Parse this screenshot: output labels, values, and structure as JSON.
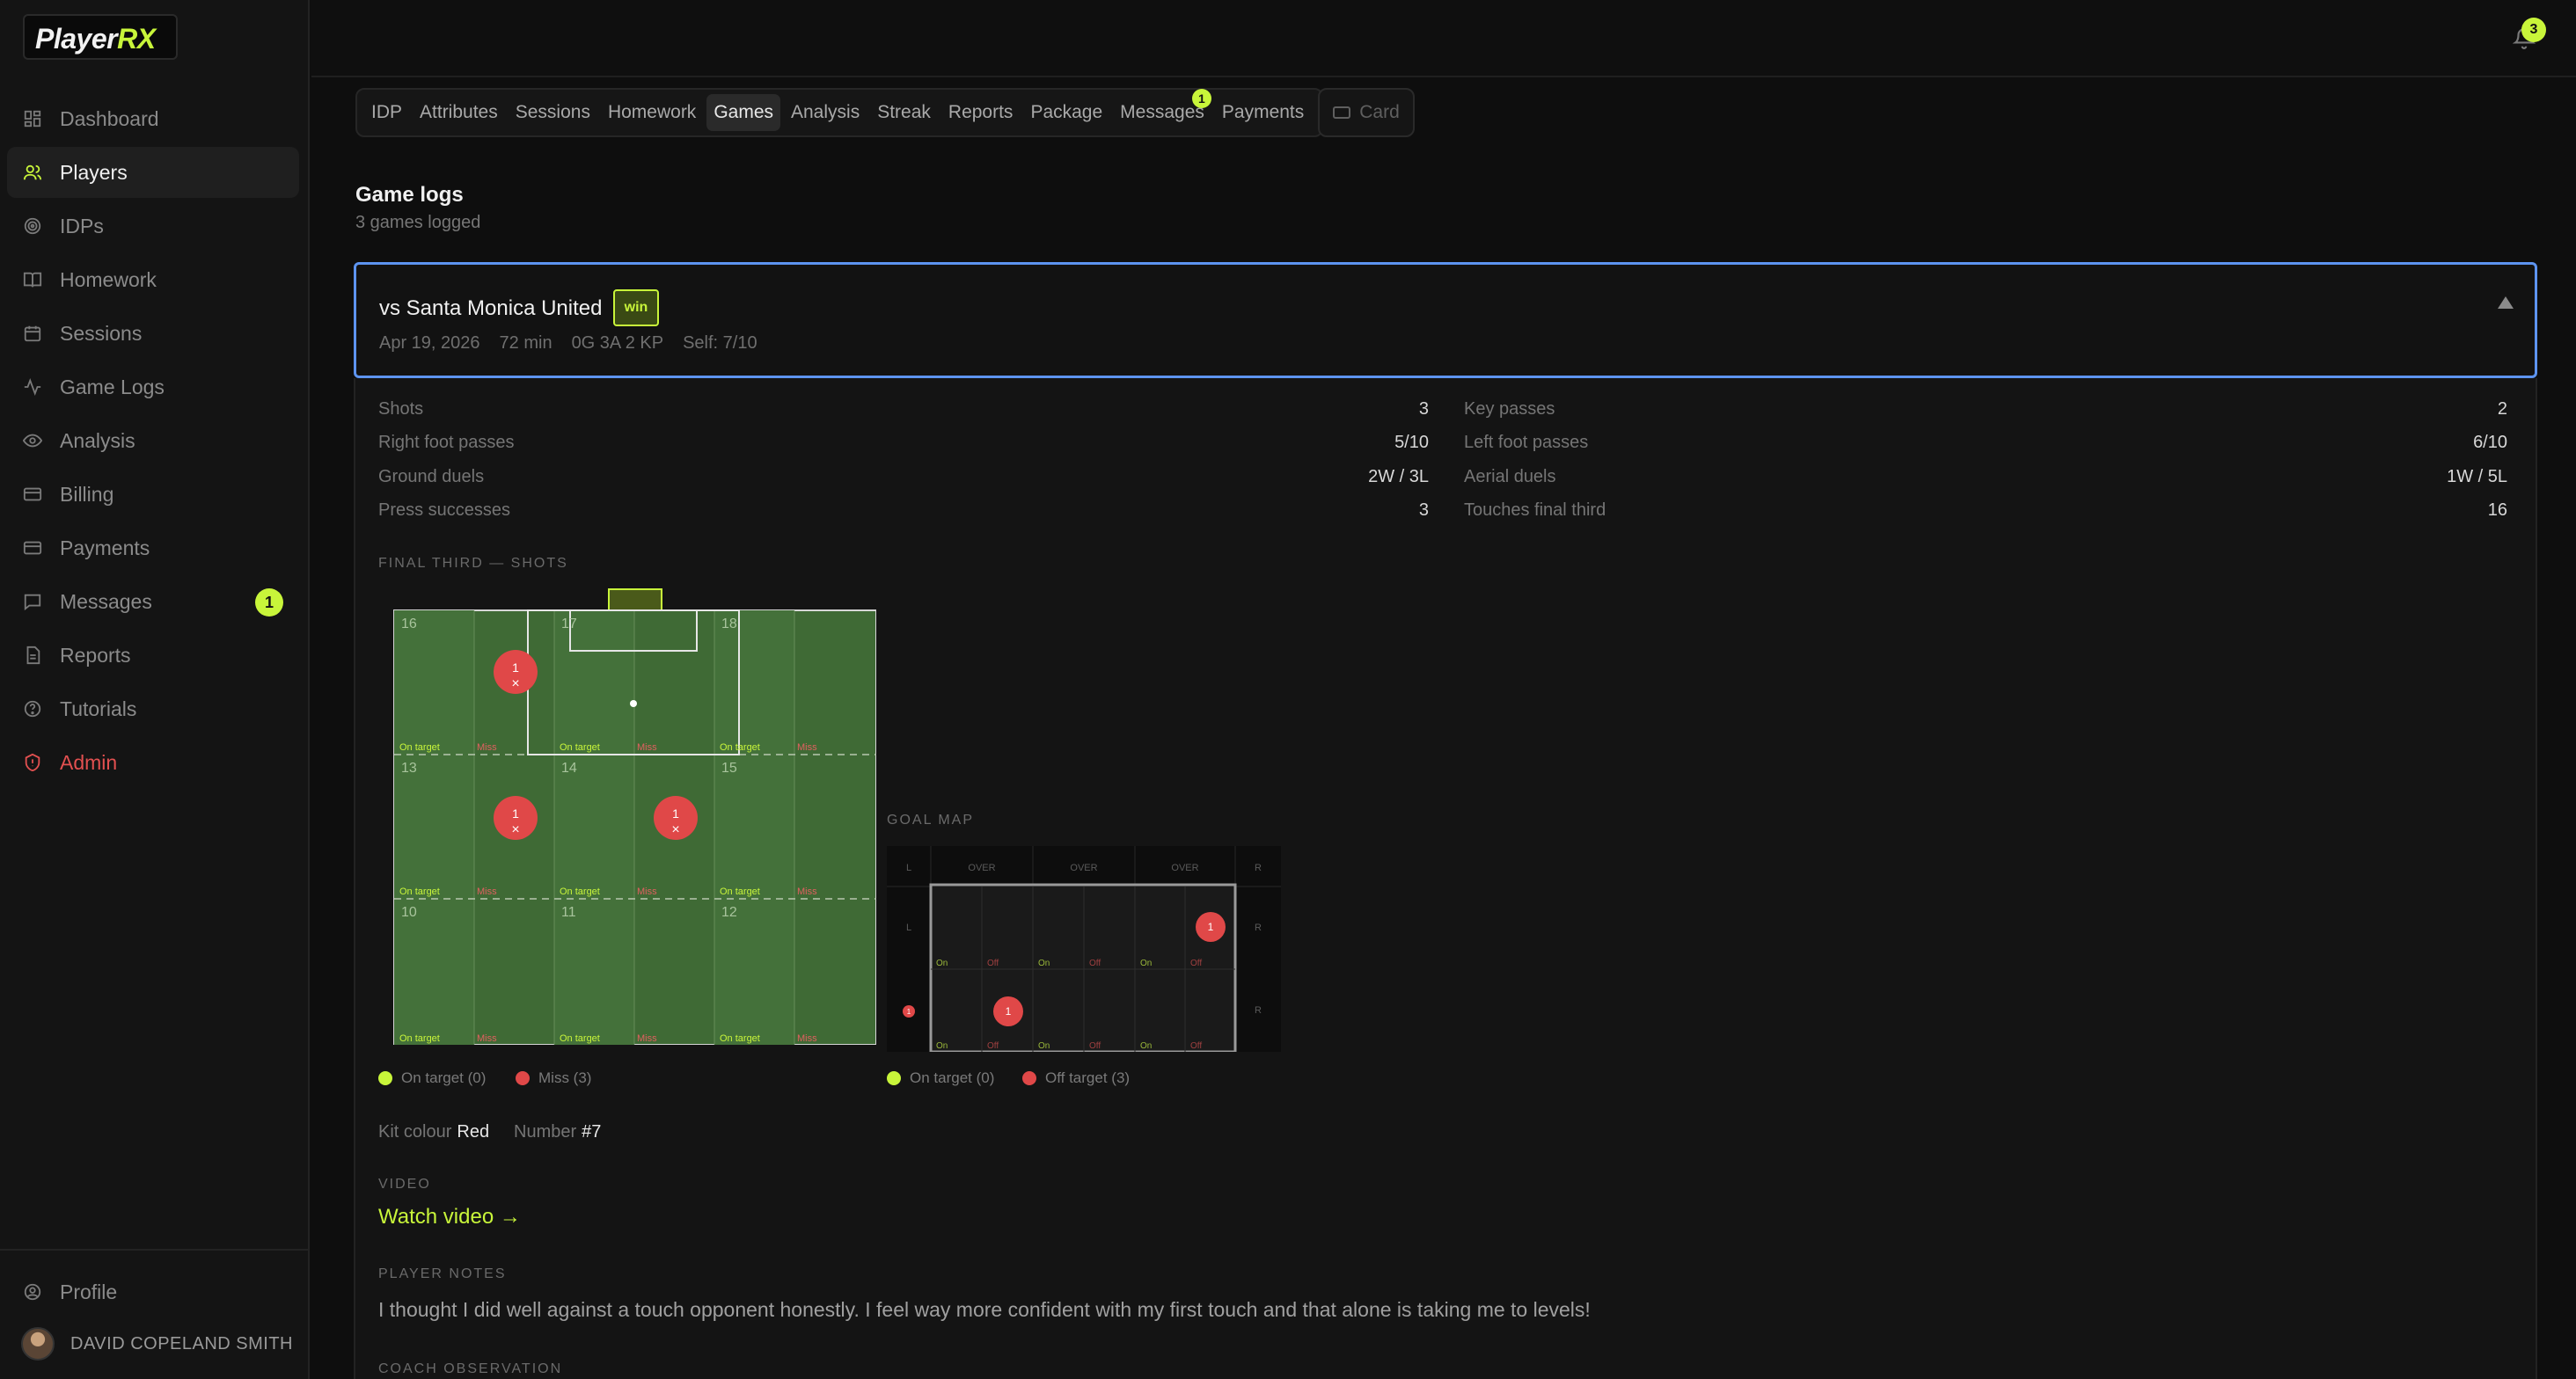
{
  "app": {
    "logo_main": "Player",
    "logo_accent": "RX"
  },
  "sidebar": {
    "items": [
      {
        "label": "Dashboard",
        "icon": "dashboard-icon"
      },
      {
        "label": "Players",
        "icon": "users-icon",
        "active": true
      },
      {
        "label": "IDPs",
        "icon": "target-icon"
      },
      {
        "label": "Homework",
        "icon": "book-icon"
      },
      {
        "label": "Sessions",
        "icon": "calendar-icon"
      },
      {
        "label": "Game Logs",
        "icon": "activity-icon"
      },
      {
        "label": "Analysis",
        "icon": "eye-icon"
      },
      {
        "label": "Billing",
        "icon": "card-icon"
      },
      {
        "label": "Payments",
        "icon": "card-icon"
      },
      {
        "label": "Messages",
        "icon": "message-icon",
        "badge": "1"
      },
      {
        "label": "Reports",
        "icon": "file-icon"
      },
      {
        "label": "Tutorials",
        "icon": "help-icon"
      },
      {
        "label": "Admin",
        "icon": "alert-icon",
        "danger": true
      }
    ],
    "profile": "Profile",
    "user": "DAVID COPELAND SMITH"
  },
  "topbar": {
    "notifications": "3"
  },
  "tabs": {
    "items": [
      "IDP",
      "Attributes",
      "Sessions",
      "Homework",
      "Games",
      "Analysis",
      "Streak",
      "Reports",
      "Package",
      "Messages",
      "Payments"
    ],
    "active": "Games",
    "messages_badge": "1",
    "card_label": "Card"
  },
  "section": {
    "title": "Game logs",
    "subtitle": "3 games logged"
  },
  "game": {
    "opponent": "vs Santa Monica United",
    "result": "win",
    "date": "Apr 19, 2026",
    "minutes": "72 min",
    "summary": "0G 3A 2 KP",
    "self_rating": "Self: 7/10",
    "stats_left": [
      {
        "label": "Shots",
        "value": "3"
      },
      {
        "label": "Right foot passes",
        "value": "5/10"
      },
      {
        "label": "Ground duels",
        "value": "2W / 3L"
      },
      {
        "label": "Press successes",
        "value": "3"
      }
    ],
    "stats_right": [
      {
        "label": "Key passes",
        "value": "2"
      },
      {
        "label": "Left foot passes",
        "value": "6/10"
      },
      {
        "label": "Aerial duels",
        "value": "1W / 5L"
      },
      {
        "label": "Touches final third",
        "value": "16"
      }
    ],
    "shots_title": "FINAL THIRD — SHOTS",
    "zone_numbers": [
      "16",
      "17",
      "18",
      "13",
      "14",
      "15",
      "10",
      "11",
      "12"
    ],
    "zone_on_label": "On target",
    "zone_miss_label": "Miss",
    "shot_markers": [
      {
        "zone": "16",
        "count": "1"
      },
      {
        "zone": "13",
        "count": "1"
      },
      {
        "zone": "14",
        "count": "1"
      }
    ],
    "shots_legend": {
      "on": "On target (0)",
      "miss": "Miss (3)"
    },
    "goal_map_title": "GOAL MAP",
    "goal_cols": [
      "L",
      "OVER",
      "OVER",
      "OVER",
      "R"
    ],
    "goal_side": "L",
    "goal_side_r": "R",
    "goal_on_label": "On",
    "goal_off_label": "Off",
    "goal_markers": [
      "1",
      "1",
      "1"
    ],
    "goal_legend": {
      "on": "On target (0)",
      "off": "Off target (3)"
    },
    "kit_label": "Kit colour",
    "kit_value": "Red",
    "number_label": "Number",
    "number_value": "#7",
    "video_title": "VIDEO",
    "video_link": "Watch video →",
    "notes_title": "PLAYER NOTES",
    "notes_text": "I thought I did well against a touch opponent honestly. I feel way more confident with my first touch and that alone is taking me to levels!",
    "coach_title": "COACH OBSERVATION"
  },
  "colors": {
    "accent": "#c8f53a",
    "miss": "#e04848",
    "pitch": "#3f6a35",
    "focus": "#5d94f0"
  }
}
